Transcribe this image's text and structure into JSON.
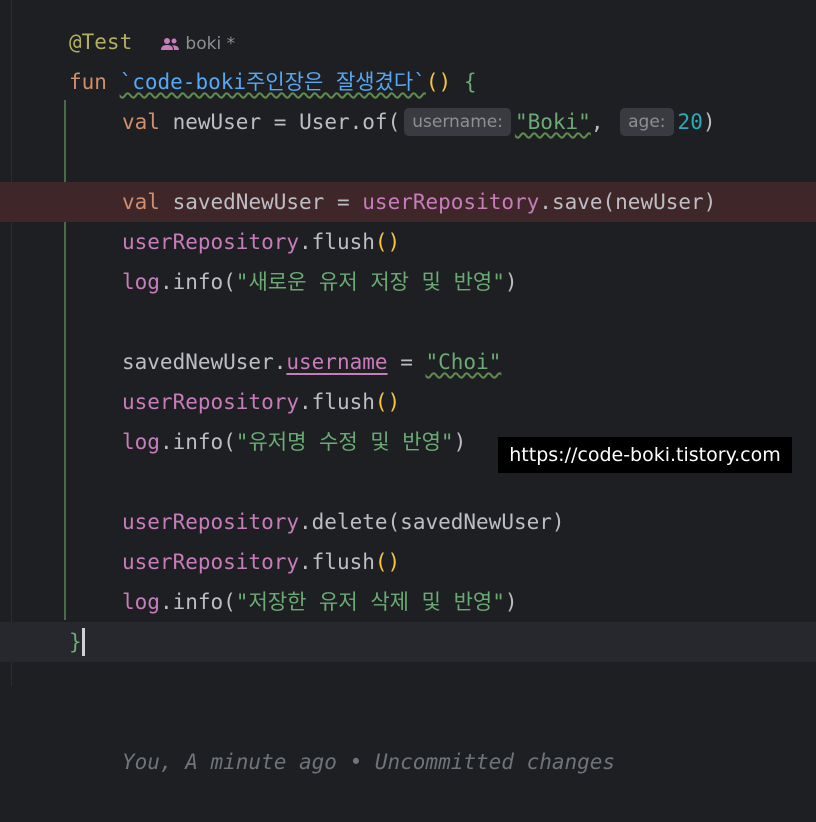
{
  "editor": {
    "annotation": "@Test",
    "author_hint": {
      "icon": "user-group-icon",
      "name": "boki",
      "modified": "*"
    },
    "function": {
      "keyword": "fun",
      "name": "`code-boki주인장은 잘생겼다`",
      "open": "()",
      "brace_open": "{",
      "brace_close": "}"
    },
    "line_val_newuser": {
      "keyword": "val",
      "var": "newUser",
      "eq": "=",
      "call": "User.of(",
      "hint_username": "username:",
      "arg_username": "\"Boki\"",
      "comma": ",",
      "hint_age": "age:",
      "arg_age": "20",
      "close": ")"
    },
    "line_val_saved": {
      "keyword": "val",
      "var": "savedNewUser",
      "eq": "=",
      "repo": "userRepository",
      "method": ".save(",
      "arg": "newUser",
      "close": ")"
    },
    "flush_repo": "userRepository",
    "flush_call": ".flush",
    "flush_parens": "()",
    "log_obj": "log",
    "log_call": ".info(",
    "log_close": ")",
    "log1_msg": "\"새로운 유저 저장 및 반영\"",
    "assign": {
      "obj": "savedNewUser",
      "dot": ".",
      "prop": "username",
      "eq": "=",
      "value": "\"Choi\""
    },
    "log2_msg": "\"유저명 수정 및 반영\"",
    "delete_call": ".delete(",
    "delete_arg": "savedNewUser",
    "log3_msg": "\"저장한 유저 삭제 및 반영\"",
    "blame": "You, A minute ago • Uncommitted changes"
  },
  "watermark": "https://code-boki.tistory.com",
  "colors": {
    "background": "#1e1f22",
    "keyword": "#cf8e6d",
    "function": "#56a8f5",
    "property": "#c77dbb",
    "string": "#6aab73",
    "number": "#2aacb8",
    "breakpoint_line": "#3f2629"
  }
}
